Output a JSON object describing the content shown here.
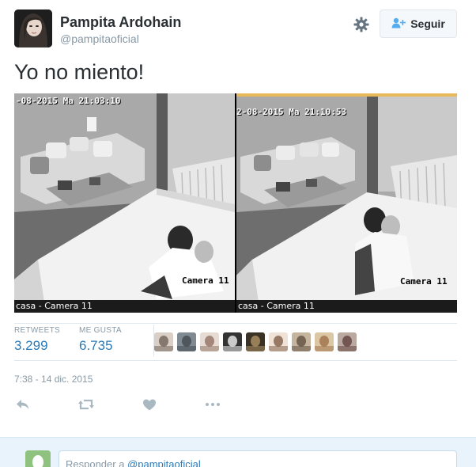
{
  "user": {
    "name": "Pampita Ardohain",
    "handle": "@pampitaoficial",
    "follow_label": "Seguir"
  },
  "tweet": {
    "text": "Yo no miento!",
    "media": {
      "left": {
        "timestamp": "-08-2015 Ma 21:03:10",
        "camera_label": "Camera 11",
        "caption": "casa - Camera 11"
      },
      "right": {
        "timestamp": "2-08-2015 Ma 21:10:53",
        "camera_label": "Camera 11",
        "caption": "casa - Camera 11"
      }
    }
  },
  "stats": {
    "retweets_label": "RETWEETS",
    "retweets_value": "3.299",
    "likes_label": "ME GUSTA",
    "likes_value": "6.735",
    "liker_count": 9
  },
  "timestamp": "7:38 - 14 dic. 2015",
  "actions": {
    "icons": [
      "reply-icon",
      "retweet-icon",
      "like-icon",
      "more-icon"
    ]
  },
  "reply": {
    "prefix": "Responder a ",
    "mention": "@pampitaoficial"
  },
  "colors": {
    "link": "#2b7bb9",
    "muted": "#8899a6",
    "text": "#292f33",
    "border": "#e1e8ed",
    "reply_bg": "#e8f3fb"
  }
}
